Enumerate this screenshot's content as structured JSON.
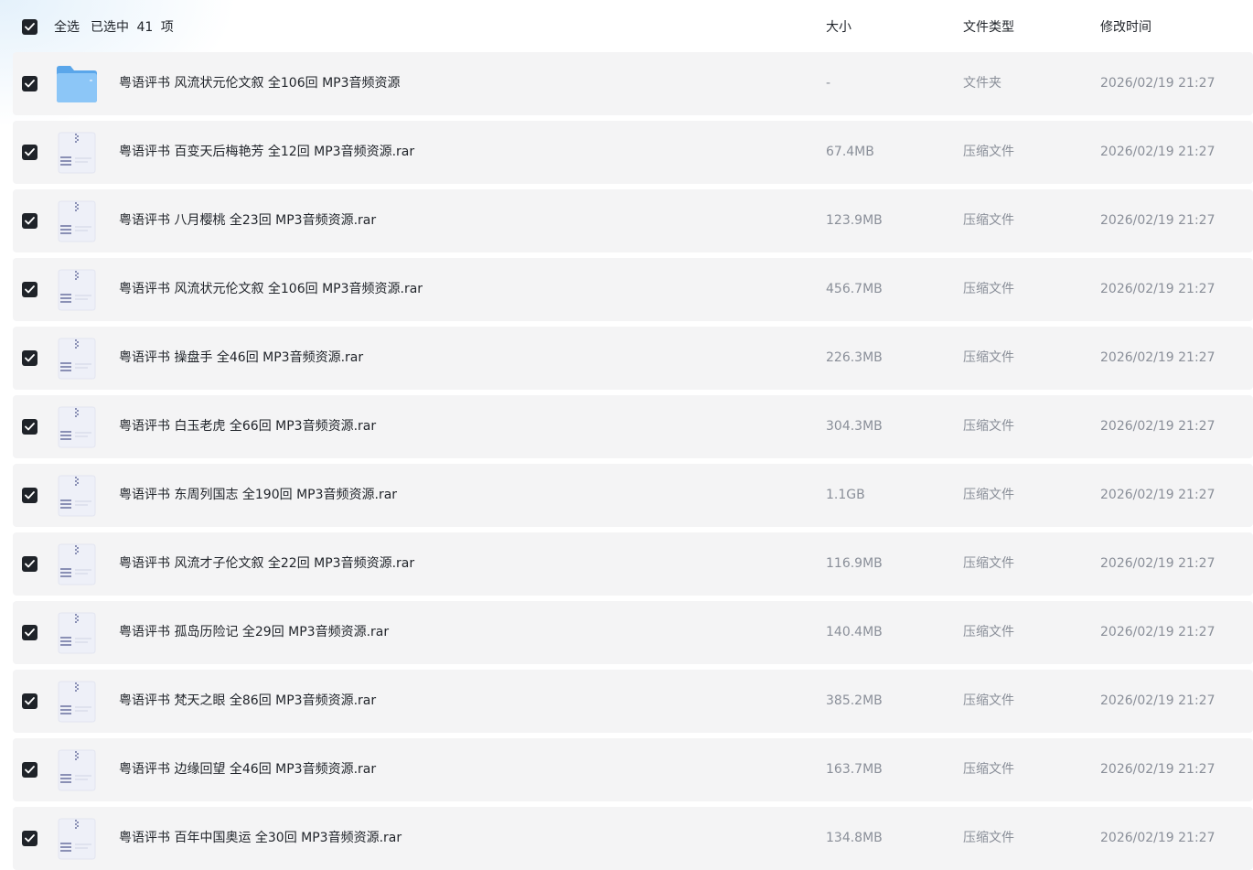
{
  "header": {
    "select_all_label": "全选",
    "selected_text": "已选中 41 项",
    "columns": {
      "size": "大小",
      "type": "文件类型",
      "modified": "修改时间"
    }
  },
  "colors": {
    "checkbox": "#1f2329",
    "row_bg": "#f4f4f5",
    "muted_text": "#8a8f99",
    "folder": "#6fb3ef"
  },
  "rows": [
    {
      "icon": "folder-icon",
      "checked": true,
      "name": "粤语评书 风流状元伦文叙 全106回 MP3音频资源",
      "size": "-",
      "type": "文件夹",
      "modified": "2026/02/19 21:27"
    },
    {
      "icon": "archive-icon",
      "checked": true,
      "name": "粤语评书 百变天后梅艳芳 全12回 MP3音频资源.rar",
      "size": "67.4MB",
      "type": "压缩文件",
      "modified": "2026/02/19 21:27"
    },
    {
      "icon": "archive-icon",
      "checked": true,
      "name": "粤语评书 八月樱桃 全23回 MP3音频资源.rar",
      "size": "123.9MB",
      "type": "压缩文件",
      "modified": "2026/02/19 21:27"
    },
    {
      "icon": "archive-icon",
      "checked": true,
      "name": "粤语评书 风流状元伦文叙 全106回 MP3音频资源.rar",
      "size": "456.7MB",
      "type": "压缩文件",
      "modified": "2026/02/19 21:27"
    },
    {
      "icon": "archive-icon",
      "checked": true,
      "name": "粤语评书 操盘手 全46回 MP3音频资源.rar",
      "size": "226.3MB",
      "type": "压缩文件",
      "modified": "2026/02/19 21:27"
    },
    {
      "icon": "archive-icon",
      "checked": true,
      "name": "粤语评书 白玉老虎 全66回 MP3音频资源.rar",
      "size": "304.3MB",
      "type": "压缩文件",
      "modified": "2026/02/19 21:27"
    },
    {
      "icon": "archive-icon",
      "checked": true,
      "name": "粤语评书 东周列国志 全190回 MP3音频资源.rar",
      "size": "1.1GB",
      "type": "压缩文件",
      "modified": "2026/02/19 21:27"
    },
    {
      "icon": "archive-icon",
      "checked": true,
      "name": "粤语评书 风流才子伦文叙 全22回 MP3音频资源.rar",
      "size": "116.9MB",
      "type": "压缩文件",
      "modified": "2026/02/19 21:27"
    },
    {
      "icon": "archive-icon",
      "checked": true,
      "name": "粤语评书 孤岛历险记 全29回 MP3音频资源.rar",
      "size": "140.4MB",
      "type": "压缩文件",
      "modified": "2026/02/19 21:27"
    },
    {
      "icon": "archive-icon",
      "checked": true,
      "name": "粤语评书 梵天之眼 全86回 MP3音频资源.rar",
      "size": "385.2MB",
      "type": "压缩文件",
      "modified": "2026/02/19 21:27"
    },
    {
      "icon": "archive-icon",
      "checked": true,
      "name": "粤语评书 边缘回望 全46回 MP3音频资源.rar",
      "size": "163.7MB",
      "type": "压缩文件",
      "modified": "2026/02/19 21:27"
    },
    {
      "icon": "archive-icon",
      "checked": true,
      "name": "粤语评书 百年中国奥运 全30回 MP3音频资源.rar",
      "size": "134.8MB",
      "type": "压缩文件",
      "modified": "2026/02/19 21:27"
    }
  ]
}
